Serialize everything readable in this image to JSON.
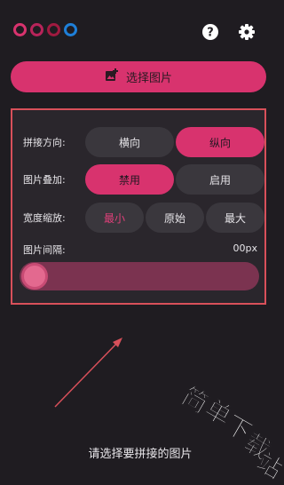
{
  "header": {
    "ring_colors": [
      "#d8336e",
      "#b8245a",
      "#a01a40",
      "#1e7fd8"
    ],
    "help_icon": "help-circle-icon",
    "settings_icon": "gear-icon"
  },
  "select_button": {
    "label": "选择图片",
    "icon": "add-photo-icon"
  },
  "options": {
    "direction": {
      "label": "拼接方向:",
      "options": [
        "横向",
        "纵向"
      ],
      "selected": "纵向"
    },
    "overlay": {
      "label": "图片叠加:",
      "options": [
        "禁用",
        "启用"
      ],
      "selected": "禁用"
    },
    "width_scale": {
      "label": "宽度缩放:",
      "options": [
        "最小",
        "原始",
        "最大"
      ],
      "selected": "最小"
    },
    "spacing": {
      "label": "图片间隔:",
      "value": "00px",
      "slider_fraction": 0
    }
  },
  "prompt": "请选择要拼接的图片",
  "watermark": {
    "text": "简单下载站"
  },
  "colors": {
    "accent": "#d8336e",
    "panel_border": "#d8505a",
    "background": "#1f1c21"
  }
}
